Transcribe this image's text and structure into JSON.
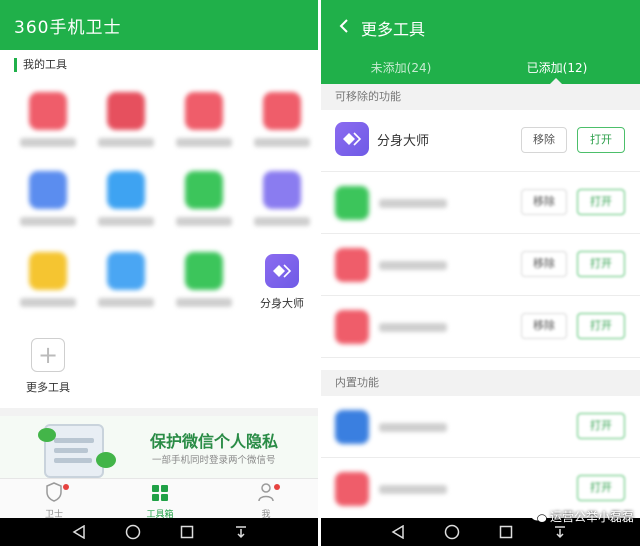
{
  "left_screen": {
    "app_title": "360手机卫士",
    "section_title": "我的工具",
    "tools": [
      {
        "color": "#ef5d6a",
        "label": ""
      },
      {
        "color": "#e6505e",
        "label": ""
      },
      {
        "color": "#ef5d6a",
        "label": ""
      },
      {
        "color": "#ef5d6a",
        "label": ""
      },
      {
        "color": "#5b8def",
        "label": ""
      },
      {
        "color": "#3ea3f2",
        "label": ""
      },
      {
        "color": "#3cc55b",
        "label": ""
      },
      {
        "color": "#8a7cf0",
        "label": ""
      },
      {
        "color": "#f5c531",
        "label": ""
      },
      {
        "color": "#4aa6f3",
        "label": ""
      },
      {
        "color": "#3cc55b",
        "label": ""
      },
      {
        "color": "#7b68ee",
        "label": "分身大师"
      }
    ],
    "more_tools_label": "更多工具",
    "banner": {
      "title": "保护微信个人隐私",
      "subtitle": "一部手机同时登录两个微信号"
    },
    "tabbar": [
      {
        "label": "卫士",
        "icon": "shield-icon",
        "active": false,
        "badge": true
      },
      {
        "label": "工具箱",
        "icon": "grid-icon",
        "active": true,
        "badge": false
      },
      {
        "label": "我",
        "icon": "person-icon",
        "active": false,
        "badge": true
      }
    ]
  },
  "right_screen": {
    "title": "更多工具",
    "tabs": [
      {
        "label": "未添加(24)",
        "active": false
      },
      {
        "label": "已添加(12)",
        "active": true
      }
    ],
    "removable_section": "可移除的功能",
    "builtin_section": "内置功能",
    "remove_label": "移除",
    "open_label": "打开",
    "removable_rows": [
      {
        "name": "分身大师",
        "color": "#7b68ee",
        "blurred": false
      },
      {
        "name": "",
        "color": "#3cc55b",
        "blurred": true
      },
      {
        "name": "",
        "color": "#ef5d6a",
        "blurred": true
      },
      {
        "name": "",
        "color": "#ef5d6a",
        "blurred": true
      }
    ],
    "builtin_rows": [
      {
        "name": "",
        "color": "#3a7fe0",
        "blurred": true
      },
      {
        "name": "",
        "color": "#ef5d6a",
        "blurred": true
      }
    ]
  },
  "watermark": "运营公举小磊磊",
  "colors": {
    "brand_green": "#20b04a",
    "badge_red": "#e64340"
  }
}
